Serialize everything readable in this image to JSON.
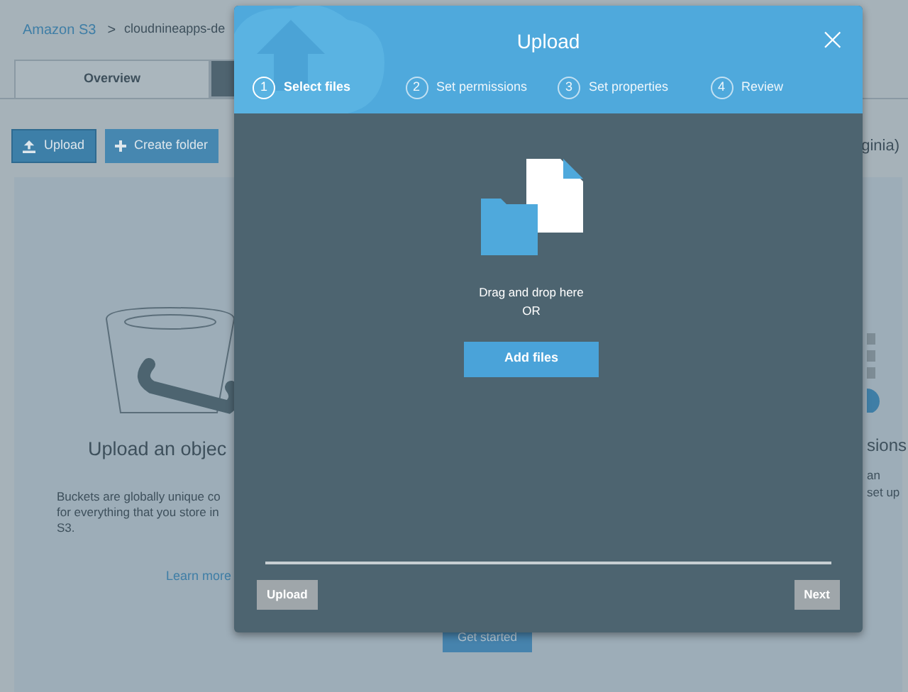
{
  "breadcrumb": {
    "root": "Amazon S3",
    "separator": ">",
    "current": "cloudnineapps-de"
  },
  "tabs": [
    {
      "label": "Overview",
      "selected": true
    },
    {
      "selected": false
    }
  ],
  "toolbar": {
    "upload": "Upload",
    "create_folder": "Create folder",
    "region": "ginia)"
  },
  "card": {
    "heading": "Upload an objec",
    "body": "Buckets are globally unique co\nfor everything that you store in\nS3.",
    "link": "Learn more",
    "button": "Get started",
    "right_heading": "sions",
    "right_body": "an\nset up"
  },
  "dialog": {
    "title": "Upload",
    "close": "×",
    "steps": [
      {
        "number": "1",
        "label": "Select files",
        "selected": true
      },
      {
        "number": "2",
        "label": "Set permissions",
        "selected": false
      },
      {
        "number": "3",
        "label": "Set properties",
        "selected": false
      },
      {
        "number": "4",
        "label": "Review",
        "selected": false
      }
    ],
    "drop_text": "Drag and drop here",
    "or_text": "OR",
    "add_button": "Add files",
    "buttons": [
      {
        "label": "Upload",
        "disabled": true
      },
      {
        "label": "Next",
        "disabled": true
      }
    ]
  }
}
